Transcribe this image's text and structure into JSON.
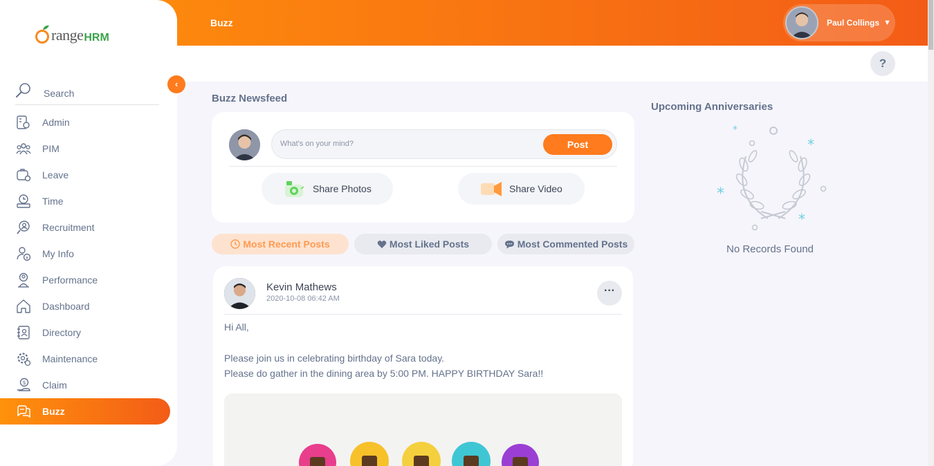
{
  "brand": {
    "logo_text": "range",
    "logo_suffix": "HRM"
  },
  "header": {
    "title": "Buzz",
    "user_name": "Paul Collings"
  },
  "help": {
    "label": "?"
  },
  "sidebar": {
    "search_label": "Search",
    "items": [
      {
        "label": "Admin",
        "icon": "admin-icon"
      },
      {
        "label": "PIM",
        "icon": "pim-icon"
      },
      {
        "label": "Leave",
        "icon": "leave-icon"
      },
      {
        "label": "Time",
        "icon": "time-icon"
      },
      {
        "label": "Recruitment",
        "icon": "recruitment-icon"
      },
      {
        "label": "My Info",
        "icon": "my-info-icon"
      },
      {
        "label": "Performance",
        "icon": "performance-icon"
      },
      {
        "label": "Dashboard",
        "icon": "dashboard-icon"
      },
      {
        "label": "Directory",
        "icon": "directory-icon"
      },
      {
        "label": "Maintenance",
        "icon": "maintenance-icon"
      },
      {
        "label": "Claim",
        "icon": "claim-icon"
      },
      {
        "label": "Buzz",
        "icon": "buzz-icon",
        "active": true
      }
    ]
  },
  "newsfeed": {
    "title": "Buzz Newsfeed",
    "composer": {
      "placeholder": "What's on your mind?",
      "post_label": "Post",
      "share_photos_label": "Share Photos",
      "share_video_label": "Share Video"
    },
    "filters": {
      "recent": "Most Recent Posts",
      "liked": "Most Liked Posts",
      "commented": "Most Commented Posts"
    },
    "post": {
      "author": "Kevin Mathews",
      "timestamp": "2020-10-08 06:42 AM",
      "lines": [
        "Hi All,",
        "Please join us in celebrating birthday of Sara today.",
        "Please do gather in the dining area by 5:00 PM. HAPPY BIRTHDAY Sara!!"
      ]
    }
  },
  "anniversaries": {
    "title": "Upcoming Anniversaries",
    "empty_text": "No Records Found"
  },
  "colors": {
    "accent": "#ff7b1d",
    "accent_dark": "#f35c17",
    "text": "#64728c"
  }
}
